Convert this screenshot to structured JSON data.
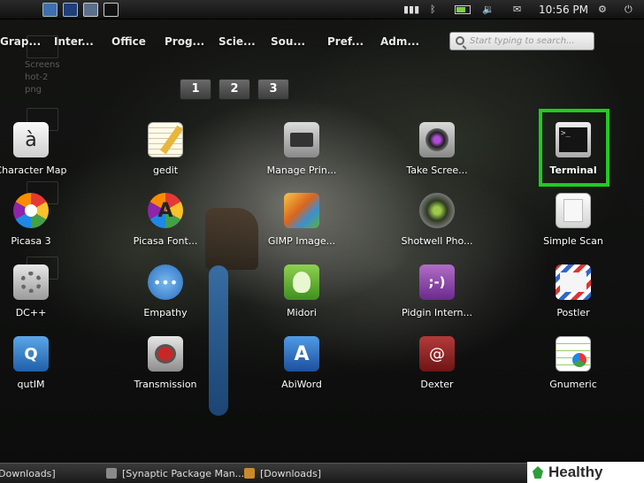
{
  "clock": "10:56 PM",
  "categories": [
    "Grap...",
    "Inter...",
    "Office",
    "Prog...",
    "Scie...",
    "Sou...",
    "Pref...",
    "Adm..."
  ],
  "search": {
    "placeholder": "Start typing to search..."
  },
  "pages": [
    "1",
    "2",
    "3"
  ],
  "ghost_icon_text": [
    "Screens",
    "hot-2",
    "png"
  ],
  "apps": [
    {
      "label": "Character Map",
      "icon": "character-map-icon"
    },
    {
      "label": "gedit",
      "icon": "gedit-icon"
    },
    {
      "label": "Manage Prin...",
      "icon": "printer-icon"
    },
    {
      "label": "Take Scree...",
      "icon": "screenshot-icon"
    },
    {
      "label": "Terminal",
      "icon": "terminal-icon"
    },
    {
      "label": "Picasa 3",
      "icon": "picasa-icon"
    },
    {
      "label": "Picasa Font...",
      "icon": "picasa-font-icon"
    },
    {
      "label": "GIMP Image...",
      "icon": "gimp-icon"
    },
    {
      "label": "Shotwell Pho...",
      "icon": "shotwell-icon"
    },
    {
      "label": "Simple Scan",
      "icon": "scanner-icon"
    },
    {
      "label": "DC++",
      "icon": "dcpp-icon"
    },
    {
      "label": "Empathy",
      "icon": "empathy-icon"
    },
    {
      "label": "Midori",
      "icon": "midori-icon"
    },
    {
      "label": "Pidgin Intern...",
      "icon": "pidgin-icon"
    },
    {
      "label": "Postler",
      "icon": "postler-icon"
    },
    {
      "label": "qutIM",
      "icon": "qutim-icon"
    },
    {
      "label": "Transmission",
      "icon": "transmission-icon"
    },
    {
      "label": "AbiWord",
      "icon": "abiword-icon"
    },
    {
      "label": "Dexter",
      "icon": "dexter-icon"
    },
    {
      "label": "Gnumeric",
      "icon": "gnumeric-icon"
    }
  ],
  "taskbar": [
    {
      "label": "Downloads]",
      "icon": "folder-icon"
    },
    {
      "label": "[Synaptic Package Man...",
      "icon": "synaptic-icon"
    },
    {
      "label": "[Downloads]",
      "icon": "folder-icon"
    }
  ],
  "watermark": "Healthy Living",
  "colors": {
    "highlight": "#1fcc1f",
    "panel": "#1a1a1a"
  }
}
